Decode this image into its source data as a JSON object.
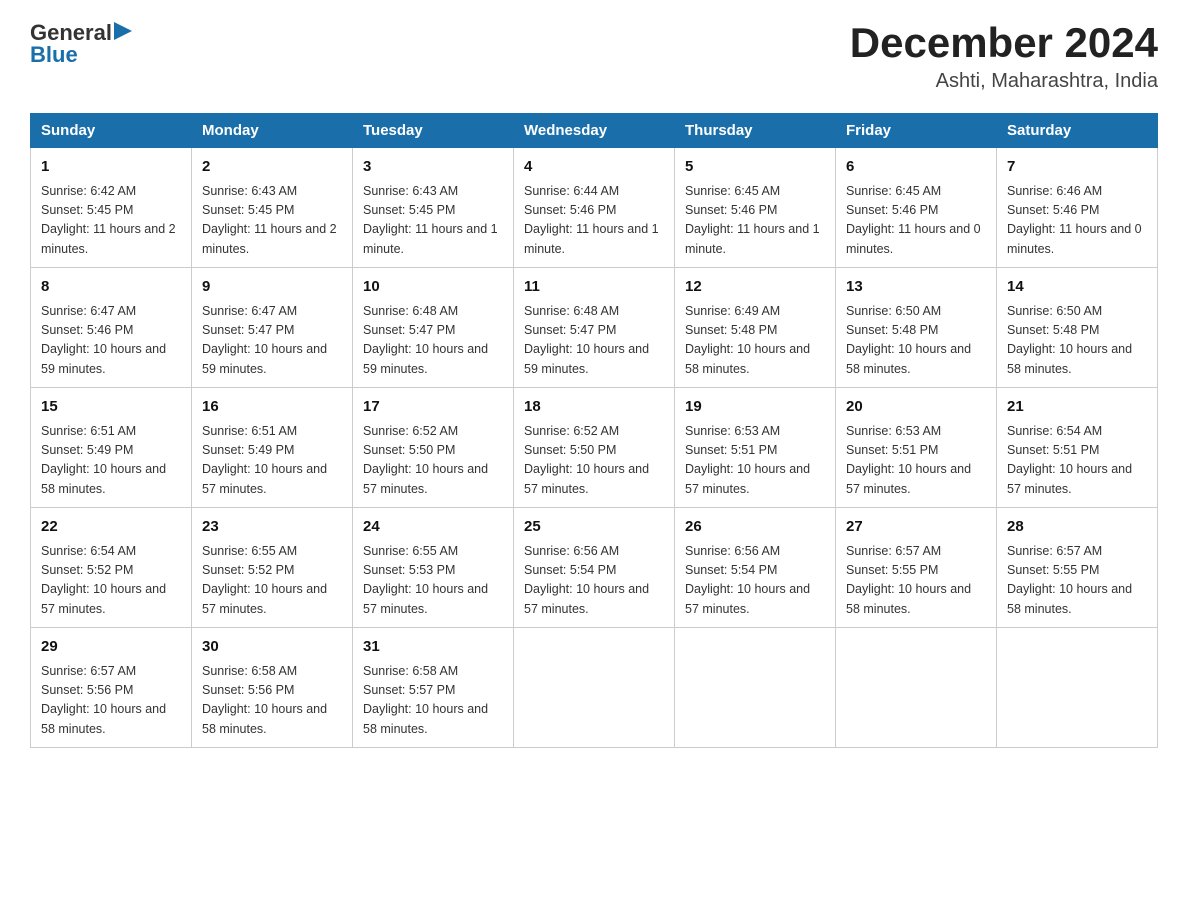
{
  "logo": {
    "text_general": "General",
    "text_blue": "Blue"
  },
  "header": {
    "title": "December 2024",
    "subtitle": "Ashti, Maharashtra, India"
  },
  "weekdays": [
    "Sunday",
    "Monday",
    "Tuesday",
    "Wednesday",
    "Thursday",
    "Friday",
    "Saturday"
  ],
  "weeks": [
    [
      {
        "day": "1",
        "sunrise": "6:42 AM",
        "sunset": "5:45 PM",
        "daylight": "11 hours and 2 minutes."
      },
      {
        "day": "2",
        "sunrise": "6:43 AM",
        "sunset": "5:45 PM",
        "daylight": "11 hours and 2 minutes."
      },
      {
        "day": "3",
        "sunrise": "6:43 AM",
        "sunset": "5:45 PM",
        "daylight": "11 hours and 1 minute."
      },
      {
        "day": "4",
        "sunrise": "6:44 AM",
        "sunset": "5:46 PM",
        "daylight": "11 hours and 1 minute."
      },
      {
        "day": "5",
        "sunrise": "6:45 AM",
        "sunset": "5:46 PM",
        "daylight": "11 hours and 1 minute."
      },
      {
        "day": "6",
        "sunrise": "6:45 AM",
        "sunset": "5:46 PM",
        "daylight": "11 hours and 0 minutes."
      },
      {
        "day": "7",
        "sunrise": "6:46 AM",
        "sunset": "5:46 PM",
        "daylight": "11 hours and 0 minutes."
      }
    ],
    [
      {
        "day": "8",
        "sunrise": "6:47 AM",
        "sunset": "5:46 PM",
        "daylight": "10 hours and 59 minutes."
      },
      {
        "day": "9",
        "sunrise": "6:47 AM",
        "sunset": "5:47 PM",
        "daylight": "10 hours and 59 minutes."
      },
      {
        "day": "10",
        "sunrise": "6:48 AM",
        "sunset": "5:47 PM",
        "daylight": "10 hours and 59 minutes."
      },
      {
        "day": "11",
        "sunrise": "6:48 AM",
        "sunset": "5:47 PM",
        "daylight": "10 hours and 59 minutes."
      },
      {
        "day": "12",
        "sunrise": "6:49 AM",
        "sunset": "5:48 PM",
        "daylight": "10 hours and 58 minutes."
      },
      {
        "day": "13",
        "sunrise": "6:50 AM",
        "sunset": "5:48 PM",
        "daylight": "10 hours and 58 minutes."
      },
      {
        "day": "14",
        "sunrise": "6:50 AM",
        "sunset": "5:48 PM",
        "daylight": "10 hours and 58 minutes."
      }
    ],
    [
      {
        "day": "15",
        "sunrise": "6:51 AM",
        "sunset": "5:49 PM",
        "daylight": "10 hours and 58 minutes."
      },
      {
        "day": "16",
        "sunrise": "6:51 AM",
        "sunset": "5:49 PM",
        "daylight": "10 hours and 57 minutes."
      },
      {
        "day": "17",
        "sunrise": "6:52 AM",
        "sunset": "5:50 PM",
        "daylight": "10 hours and 57 minutes."
      },
      {
        "day": "18",
        "sunrise": "6:52 AM",
        "sunset": "5:50 PM",
        "daylight": "10 hours and 57 minutes."
      },
      {
        "day": "19",
        "sunrise": "6:53 AM",
        "sunset": "5:51 PM",
        "daylight": "10 hours and 57 minutes."
      },
      {
        "day": "20",
        "sunrise": "6:53 AM",
        "sunset": "5:51 PM",
        "daylight": "10 hours and 57 minutes."
      },
      {
        "day": "21",
        "sunrise": "6:54 AM",
        "sunset": "5:51 PM",
        "daylight": "10 hours and 57 minutes."
      }
    ],
    [
      {
        "day": "22",
        "sunrise": "6:54 AM",
        "sunset": "5:52 PM",
        "daylight": "10 hours and 57 minutes."
      },
      {
        "day": "23",
        "sunrise": "6:55 AM",
        "sunset": "5:52 PM",
        "daylight": "10 hours and 57 minutes."
      },
      {
        "day": "24",
        "sunrise": "6:55 AM",
        "sunset": "5:53 PM",
        "daylight": "10 hours and 57 minutes."
      },
      {
        "day": "25",
        "sunrise": "6:56 AM",
        "sunset": "5:54 PM",
        "daylight": "10 hours and 57 minutes."
      },
      {
        "day": "26",
        "sunrise": "6:56 AM",
        "sunset": "5:54 PM",
        "daylight": "10 hours and 57 minutes."
      },
      {
        "day": "27",
        "sunrise": "6:57 AM",
        "sunset": "5:55 PM",
        "daylight": "10 hours and 58 minutes."
      },
      {
        "day": "28",
        "sunrise": "6:57 AM",
        "sunset": "5:55 PM",
        "daylight": "10 hours and 58 minutes."
      }
    ],
    [
      {
        "day": "29",
        "sunrise": "6:57 AM",
        "sunset": "5:56 PM",
        "daylight": "10 hours and 58 minutes."
      },
      {
        "day": "30",
        "sunrise": "6:58 AM",
        "sunset": "5:56 PM",
        "daylight": "10 hours and 58 minutes."
      },
      {
        "day": "31",
        "sunrise": "6:58 AM",
        "sunset": "5:57 PM",
        "daylight": "10 hours and 58 minutes."
      },
      null,
      null,
      null,
      null
    ]
  ]
}
